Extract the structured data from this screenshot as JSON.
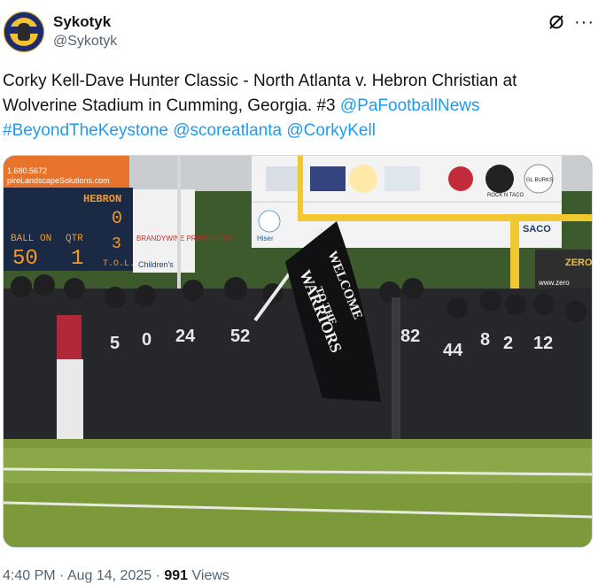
{
  "author": {
    "name": "Sykotyk",
    "handle": "@Sykotyk"
  },
  "tweet": {
    "text_plain": "Corky Kell-Dave Hunter Classic - North Atlanta v. Hebron Christian at Wolverine Stadium in Cumming, Georgia. #3 ",
    "links": [
      "@PaFootballNews",
      "#BeyondTheKeystone",
      "@scoreatlanta",
      "@CorkyKell"
    ]
  },
  "scoreboard": {
    "home_label": "HEBRON",
    "home_score": "0",
    "ball_on_label": "BALL ON",
    "ball_on": "50",
    "qtr_label": "QTR",
    "qtr": "1",
    "to_label": "T.O.L.",
    "to_value": "3",
    "phone": "1.680.5672",
    "site": "pireLandscapeSolutions.com"
  },
  "banners": {
    "sponsor_sign": "BRANDYWINE PRINTING INC.",
    "children_sign": "Children's",
    "hiser": "Hiser",
    "saco": "SACO",
    "rock": "ROCK N TACO",
    "glburks": "GL BURKS",
    "zero": "ZERO",
    "zero_url": "www.zero"
  },
  "flag": {
    "line1": "WELCOME",
    "line2": "TO THE",
    "line3": "WARRIORS"
  },
  "jersey_numbers": [
    "5",
    "0",
    "24",
    "52",
    "82",
    "44",
    "8",
    "2",
    "12"
  ],
  "meta": {
    "time": "4:40 PM",
    "date": "Aug 14, 2025",
    "views_count": "991",
    "views_label": "Views"
  }
}
